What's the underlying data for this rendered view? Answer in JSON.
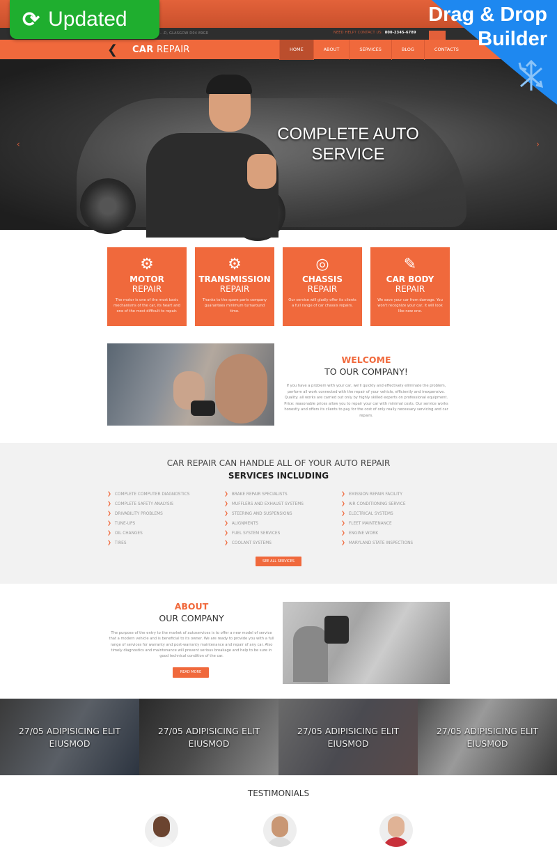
{
  "badges": {
    "updated": "Updated",
    "updated_icon": "refresh-icon",
    "builder_line1": "Drag & Drop",
    "builder_line2": "Builder",
    "builder_icon": "move-arrows-icon"
  },
  "infobar": {
    "address": "...D, GLASGOW D04 89GR",
    "help_text": "NEED HELP? CONTACT US:",
    "phone": "800-2345-6789"
  },
  "header": {
    "back_icon": "chevron-left-icon",
    "logo_bold": "CAR",
    "logo_rest": " REPAIR",
    "nav": [
      {
        "label": "HOME",
        "active": true
      },
      {
        "label": "ABOUT",
        "active": false
      },
      {
        "label": "SERVICES",
        "active": false
      },
      {
        "label": "BLOG",
        "active": false
      },
      {
        "label": "CONTACTS",
        "active": false
      }
    ]
  },
  "hero": {
    "title_line1": "COMPLETE AUTO",
    "title_line2": "SERVICE",
    "prev": "‹",
    "next": "›"
  },
  "features": [
    {
      "icon": "piston-icon",
      "glyph": "⚙",
      "title": "MOTOR",
      "subtitle": "REPAIR",
      "text": "The motor is one of the most basic mechanisms of the car, its heart and one of the most difficult to repair."
    },
    {
      "icon": "gears-icon",
      "glyph": "⚙",
      "title": "TRANSMISSION",
      "subtitle": "REPAIR",
      "text": "Thanks to the spare parts company guarantees minimum turnaround time."
    },
    {
      "icon": "brake-disc-icon",
      "glyph": "◎",
      "title": "CHASSIS",
      "subtitle": "REPAIR",
      "text": "Our service will gladly offer its clients a full range of car chassis repairs."
    },
    {
      "icon": "paint-brush-icon",
      "glyph": "✎",
      "title": "CAR BODY",
      "subtitle": "REPAIR",
      "text": "We save your car from damage. You won't recognize your car, it will look like new one."
    }
  ],
  "welcome": {
    "title": "WELCOME",
    "subtitle": "TO OUR COMPANY!",
    "text": "If you have a problem with your car, we'll quickly and effectively eliminate the problem, perform all work connected with the repair of your vehicle, efficiently and inexpensive. Quality: all works are carried out only by highly skilled experts on professional equipment. Price: reasonable prices allow you to repair your car with minimal costs. Our service works honestly and offers its clients to pay for the cost of only really necessary servicing and car repairs."
  },
  "services": {
    "title_line1": "CAR REPAIR CAN HANDLE ALL OF YOUR AUTO REPAIR",
    "title_line2": "SERVICES INCLUDING",
    "columns": [
      [
        "COMPLETE COMPUTER DIAGNOSTICS",
        "COMPLETE SAFETY ANALYSIS",
        "DRIVABILITY PROBLEMS",
        "TUNE-UPS",
        "OIL CHANGES",
        "TIRES"
      ],
      [
        "BRAKE REPAIR SPECIALISTS",
        "MUFFLERS AND EXHAUST SYSTEMS",
        "STEERING AND SUSPENSIONS",
        "ALIGNMENTS",
        "FUEL SYSTEM SERVICES",
        "COOLANT SYSTEMS"
      ],
      [
        "EMISSION REPAIR FACILITY",
        "AIR CONDITIONING SERVICE",
        "ELECTRICAL SYSTEMS",
        "FLEET MAINTENANCE",
        "ENGINE WORK",
        "MARYLAND STATE INSPECTIONS"
      ]
    ],
    "button": "SEE ALL SERVICES"
  },
  "about": {
    "title": "ABOUT",
    "subtitle": "OUR COMPANY",
    "text": "The purpose of the entry to the market of autoservices is to offer a new model of service that a modern vehicle and is beneficial to its owner. We are ready to provide you with a full range of services for warranty and post-warranty maintenance and repair of any car. Also timely diagnostics and maintenance will prevent serious breakage and help to be sure in good technical condition of the car.",
    "button": "READ MORE"
  },
  "news": [
    {
      "line1": "27/05 ADIPISICING ELIT",
      "line2": "EIUSMOD"
    },
    {
      "line1": "27/05 ADIPISICING ELIT",
      "line2": "EIUSMOD"
    },
    {
      "line1": "27/05 ADIPISICING ELIT",
      "line2": "EIUSMOD"
    },
    {
      "line1": "27/05 ADIPISICING ELIT",
      "line2": "EIUSMOD"
    }
  ],
  "testimonials": {
    "title": "TESTIMONIALS"
  },
  "colors": {
    "accent": "#f0693c",
    "updated_green": "#1fae2f",
    "builder_blue": "#1e88f0",
    "dark": "#2e2e2e"
  }
}
